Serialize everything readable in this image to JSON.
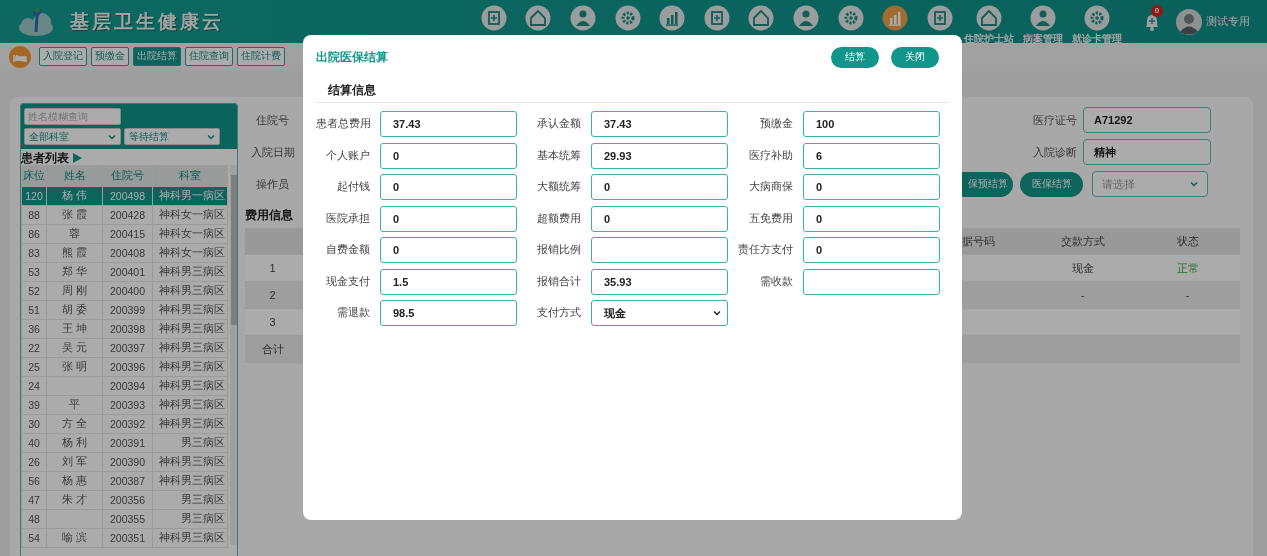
{
  "header": {
    "title": "基层卫生健康云",
    "nav": [
      {
        "selected": false
      },
      {
        "selected": false
      },
      {
        "selected": false
      },
      {
        "selected": false
      },
      {
        "selected": false
      },
      {
        "selected": false
      },
      {
        "selected": false
      },
      {
        "selected": false
      },
      {
        "selected": false
      },
      {
        "selected": true
      },
      {
        "selected": false
      },
      {
        "label": "住院护士站",
        "selected": false
      },
      {
        "label": "病案管理",
        "selected": false
      },
      {
        "label": "就诊卡管理",
        "selected": false
      }
    ],
    "notifications": "0",
    "user": "测试专用"
  },
  "subnav": {
    "tabs": [
      {
        "label": "入院登记",
        "selected": false
      },
      {
        "label": "预缴金",
        "selected": false
      },
      {
        "label": "出院结算",
        "selected": true
      },
      {
        "label": "住院查询",
        "selected": false
      },
      {
        "label": "住院计费",
        "selected": false
      }
    ]
  },
  "patients": {
    "search_placeholder": "姓名模糊查询",
    "department_filter": "全部科室",
    "status_filter": "等待结算",
    "title": "患者列表",
    "columns": [
      "床位",
      "姓名",
      "住院号",
      "科室"
    ],
    "rows": [
      {
        "bed": "120",
        "name": "杨 伟",
        "admission_no": "200498",
        "department": "神科男一病区",
        "selected": true
      },
      {
        "bed": "88",
        "name": "张 霞",
        "admission_no": "200428",
        "department": "神科女一病区",
        "selected": false
      },
      {
        "bed": "86",
        "name": "蓉",
        "admission_no": "200415",
        "department": "神科女一病区",
        "selected": false
      },
      {
        "bed": "83",
        "name": "熊 霞",
        "admission_no": "200408",
        "department": "神科女一病区",
        "selected": false
      },
      {
        "bed": "53",
        "name": "郑 华",
        "admission_no": "200401",
        "department": "神科男三病区",
        "selected": false
      },
      {
        "bed": "52",
        "name": "周 刚",
        "admission_no": "200400",
        "department": "神科男三病区",
        "selected": false
      },
      {
        "bed": "51",
        "name": "胡 委",
        "admission_no": "200399",
        "department": "神科男三病区",
        "selected": false
      },
      {
        "bed": "36",
        "name": "王 坤",
        "admission_no": "200398",
        "department": "神科男三病区",
        "selected": false
      },
      {
        "bed": "22",
        "name": "吴 元",
        "admission_no": "200397",
        "department": "神科男三病区",
        "selected": false
      },
      {
        "bed": "25",
        "name": "张 明",
        "admission_no": "200396",
        "department": "神科男三病区",
        "selected": false
      },
      {
        "bed": "24",
        "admission_no": "200394",
        "department": "神科男三病区",
        "selected": false
      },
      {
        "bed": "39",
        "name": "平",
        "admission_no": "200393",
        "department": "神科男三病区",
        "selected": false
      },
      {
        "bed": "30",
        "name": "方 全",
        "admission_no": "200392",
        "department": "神科男三病区",
        "selected": false
      },
      {
        "bed": "40",
        "name": "杨 利",
        "admission_no": "200391",
        "department": "男三病区",
        "selected": false
      },
      {
        "bed": "26",
        "name": "刘 军",
        "admission_no": "200390",
        "department": "神科男三病区",
        "selected": false
      },
      {
        "bed": "56",
        "name": "杨 惠",
        "admission_no": "200387",
        "department": "神科男三病区",
        "selected": false
      },
      {
        "bed": "47",
        "name": "朱 才",
        "admission_no": "200356",
        "department": "男三病区",
        "selected": false
      },
      {
        "bed": "48",
        "admission_no": "200355",
        "department": "男三病区",
        "selected": false
      },
      {
        "bed": "54",
        "name": "喻 滨",
        "admission_no": "200351",
        "department": "神科男三病区",
        "selected": false
      }
    ]
  },
  "admission": {
    "labels": [
      "住院号",
      "入院日期",
      "操作员"
    ],
    "card_label": "医疗证号",
    "card_value": "A71292",
    "diagnosis_label": "入院诊断",
    "diagnosis_value": "精神",
    "buttons": [
      "保预结算",
      "医保结算"
    ],
    "select_placeholder": "请选择"
  },
  "fees": {
    "title": "费用信息",
    "columns": [
      "据号码",
      "交款方式",
      "状态"
    ],
    "rows": [
      {
        "label": "1",
        "payment": "现金",
        "status": "正常",
        "status_ok": true
      },
      {
        "label": "2",
        "payment": "-",
        "status": "-",
        "status_ok": false
      },
      {
        "label": "3"
      },
      {
        "label": "合计"
      }
    ]
  },
  "modal": {
    "title": "出院医保结算",
    "buttons": [
      "结算",
      "关闭"
    ],
    "section": "结算信息",
    "fields": [
      {
        "label": "患者总费用",
        "value": "37.43",
        "kind": "input"
      },
      {
        "label": "承认金额",
        "value": "37.43",
        "kind": "input"
      },
      {
        "label": "预缴金",
        "value": "100",
        "kind": "input"
      },
      {
        "label": "个人账户",
        "value": "0",
        "kind": "input"
      },
      {
        "label": "基本统筹",
        "value": "29.93",
        "kind": "input"
      },
      {
        "label": "医疗补助",
        "value": "6",
        "kind": "input"
      },
      {
        "label": "起付钱",
        "value": "0",
        "kind": "input"
      },
      {
        "label": "大额统筹",
        "value": "0",
        "kind": "input"
      },
      {
        "label": "大病商保",
        "value": "0",
        "kind": "input"
      },
      {
        "label": "医院承担",
        "value": "0",
        "kind": "input"
      },
      {
        "label": "超额费用",
        "value": "0",
        "kind": "input"
      },
      {
        "label": "五免费用",
        "value": "0",
        "kind": "input"
      },
      {
        "label": "自费金额",
        "value": "0",
        "kind": "input"
      },
      {
        "label": "报销比例",
        "kind": "input"
      },
      {
        "label": "责任方支付",
        "value": "0",
        "kind": "input"
      },
      {
        "label": "现金支付",
        "value": "1.5",
        "kind": "input"
      },
      {
        "label": "报销合计",
        "value": "35.93",
        "kind": "input"
      },
      {
        "label": "需收款",
        "kind": "input"
      },
      {
        "label": "需退款",
        "value": "98.5",
        "kind": "input"
      },
      {
        "label": "支付方式",
        "value": "现金",
        "kind": "select"
      }
    ]
  }
}
